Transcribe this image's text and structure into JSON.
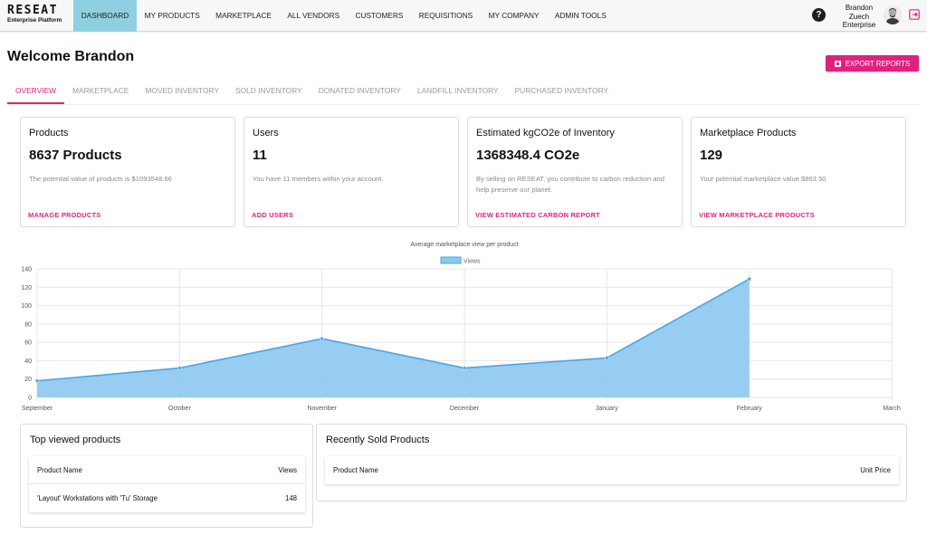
{
  "app": {
    "brand": "RESEAT",
    "subtitle": "Enterprise Platform"
  },
  "nav": [
    {
      "label": "DASHBOARD",
      "active": true
    },
    {
      "label": "MY PRODUCTS"
    },
    {
      "label": "MARKETPLACE"
    },
    {
      "label": "ALL VENDORS"
    },
    {
      "label": "CUSTOMERS"
    },
    {
      "label": "REQUISITIONS"
    },
    {
      "label": "MY COMPANY"
    },
    {
      "label": "ADMIN TOOLS"
    }
  ],
  "user": {
    "line1": "Brandon",
    "line2": "Zuech",
    "line3": "Enterprise",
    "help_icon": "question-circle-icon",
    "logout_icon": "logout-icon"
  },
  "header": {
    "welcome": "Welcome Brandon",
    "export_label": "EXPORT REPORTS"
  },
  "tabs": [
    {
      "label": "OVERVIEW",
      "active": true
    },
    {
      "label": "MARKETPLACE"
    },
    {
      "label": "MOVED INVENTORY"
    },
    {
      "label": "SOLD INVENTORY"
    },
    {
      "label": "DONATED INVENTORY"
    },
    {
      "label": "LANDFILL INVENTORY"
    },
    {
      "label": "PURCHASED INVENTORY"
    }
  ],
  "cards": [
    {
      "title": "Products",
      "value": "8637 Products",
      "desc": "The potential value of products is $1093548.66",
      "link": "MANAGE PRODUCTS"
    },
    {
      "title": "Users",
      "value": "11",
      "desc": "You have 11 members within your account.",
      "link": "ADD USERS"
    },
    {
      "title": "Estimated kgCO2e of Inventory",
      "value": "1368348.4 CO2e",
      "desc": "By selling on RESEAT, you contribute to carbon reduction and help preserve our planet.",
      "link": "VIEW ESTIMATED CARBON REPORT"
    },
    {
      "title": "Marketplace Products",
      "value": "129",
      "desc": "Your potential marketplace value $863.50",
      "link": "VIEW MARKETPLACE PRODUCTS"
    }
  ],
  "chart_data": {
    "type": "area",
    "title": "Average marketplace view per product",
    "xlabel": "",
    "ylabel": "",
    "categories": [
      "September",
      "October",
      "November",
      "December",
      "January",
      "February",
      "March"
    ],
    "series": [
      {
        "name": "Views",
        "values": [
          18,
          32,
          64,
          32,
          43,
          129,
          null
        ]
      }
    ],
    "ylim": [
      0,
      140
    ],
    "yticks": [
      0,
      20,
      40,
      60,
      80,
      100,
      120,
      140
    ],
    "grid": true,
    "legend": "top",
    "colors": {
      "fill": "#8ec9ef",
      "line": "#4aa5e4"
    }
  },
  "top_viewed": {
    "title": "Top viewed products",
    "headers": {
      "name": "Product Name",
      "views": "Views"
    },
    "rows": [
      {
        "name": "'Layout' Workstations with 'Tu' Storage",
        "views": "148"
      }
    ]
  },
  "recently_sold": {
    "title": "Recently Sold Products",
    "headers": {
      "name": "Product Name",
      "price": "Unit Price"
    },
    "rows": []
  },
  "colors": {
    "accent": "#e0227f",
    "nav_active": "#8fd0e0"
  }
}
